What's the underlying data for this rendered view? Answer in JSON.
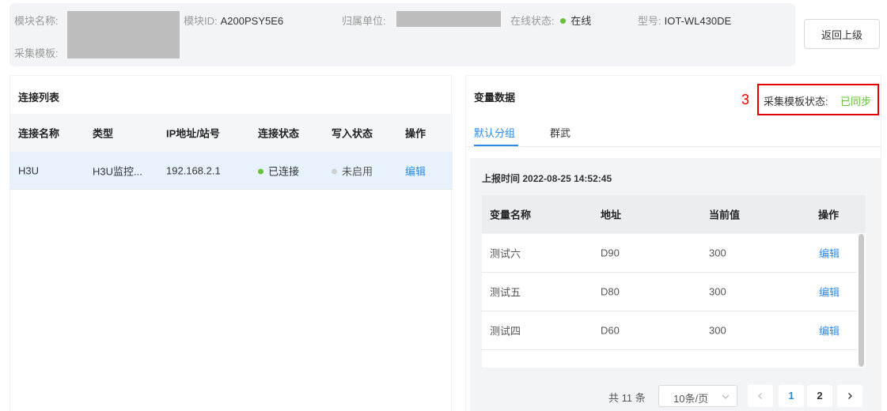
{
  "info": {
    "module_name_label": "模块名称:",
    "module_id_label": "模块ID:",
    "module_id": "A200PSY5E6",
    "owner_label": "归属单位:",
    "online_label": "在线状态:",
    "online_value": "在线",
    "model_label": "型号:",
    "model_value": "IOT-WL430DE",
    "template_label": "采集模板:",
    "online_color": "#67c23a"
  },
  "back_button": "返回上级",
  "left": {
    "title": "连接列表",
    "columns": [
      "连接名称",
      "类型",
      "IP地址/站号",
      "连接状态",
      "写入状态",
      "操作"
    ],
    "rows": [
      {
        "name": "H3U",
        "type": "H3U监控...",
        "ip": "192.168.2.1",
        "conn_status": "已连接",
        "write_status": "未启用",
        "action": "编辑"
      }
    ]
  },
  "right": {
    "title": "变量数据",
    "annotation_number": "3",
    "sync_label": "采集模板状态:",
    "sync_value": "已同步",
    "tabs": [
      "默认分组",
      "群武"
    ],
    "report_label": "上报时间",
    "report_time": "2022-08-25 14:52:45",
    "columns": [
      "变量名称",
      "地址",
      "当前值",
      "操作"
    ],
    "rows": [
      {
        "name": "测试六",
        "address": "D90",
        "value": "300",
        "action": "编辑"
      },
      {
        "name": "测试五",
        "address": "D80",
        "value": "300",
        "action": "编辑"
      },
      {
        "name": "测试四",
        "address": "D60",
        "value": "300",
        "action": "编辑"
      }
    ],
    "pager": {
      "total": "共 11 条",
      "page_size": "10条/页",
      "pages": [
        "1",
        "2"
      ],
      "current": "1"
    }
  },
  "colors": {
    "accent": "#2e8ae6",
    "success": "#67c23a",
    "annotation": "#e60000"
  }
}
